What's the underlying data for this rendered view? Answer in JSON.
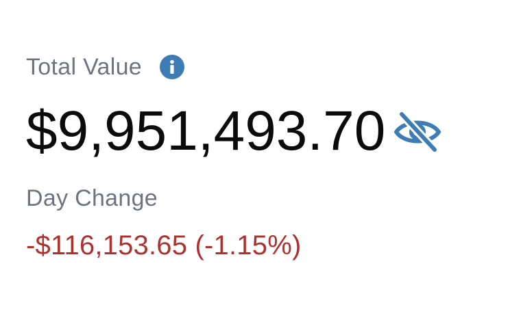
{
  "portfolio": {
    "total_label": "Total Value",
    "total_value": "$9,951,493.70",
    "day_change_label": "Day Change",
    "day_change_value": "-$116,153.65 (-1.15%)"
  },
  "icons": {
    "info": "info-icon",
    "visibility_toggle": "eye-slash-icon"
  },
  "colors": {
    "label_gray": "#6b7480",
    "value_black": "#0b0b0b",
    "accent_blue": "#3d7db3",
    "loss_red": "#b0302e"
  }
}
